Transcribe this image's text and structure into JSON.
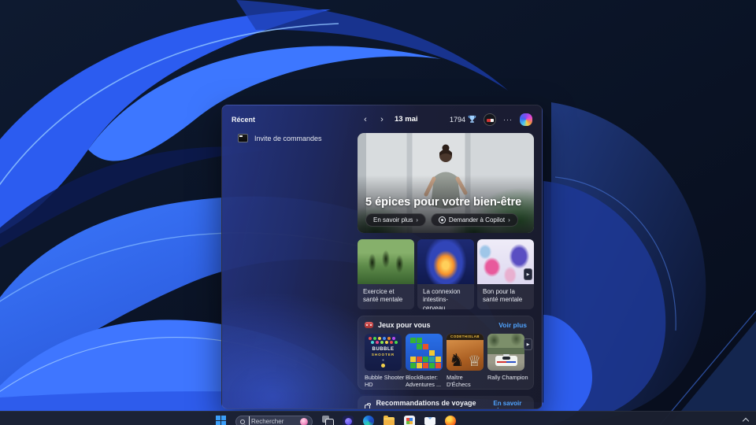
{
  "widgets": {
    "recent": {
      "title": "Récent",
      "items": [
        {
          "label": "Invite de commandes"
        }
      ]
    },
    "header": {
      "date": "13 mai",
      "points": "1794",
      "more_label": "···"
    },
    "hero": {
      "title": "5 épices pour votre bien-être",
      "learn_more": "En savoir plus",
      "ask_copilot": "Demander à Copilot"
    },
    "news": [
      {
        "title": "Exercice et santé mentale"
      },
      {
        "title": "La connexion intestins-cerveau"
      },
      {
        "title": "Bon pour la santé mentale"
      }
    ],
    "games": {
      "title": "Jeux pour vous",
      "see_more": "Voir plus",
      "items": [
        {
          "title": "Bubble Shooter HD",
          "art_line1": "BUBBLE",
          "art_line2": "SHOOTER"
        },
        {
          "title": "BlockBuster: Adventures ..."
        },
        {
          "title": "Maître D'Échecs",
          "banner": "CODETHISLAB",
          "piece_left": "♞",
          "piece_right": "♕"
        },
        {
          "title": "Rally Champion"
        }
      ]
    },
    "travel": {
      "title": "Recommandations de voyage pour vous",
      "link": "En savoir plus"
    }
  },
  "taskbar": {
    "search_placeholder": "Rechercher"
  },
  "icons": {
    "nav_prev": "‹",
    "nav_next": "›",
    "carousel_next": "▶",
    "button_chevron": "›"
  },
  "colors": {
    "accent_link": "#4fa3ff",
    "panel_left_blue": "#24347e",
    "panel_right_dark": "#1b1e30",
    "card_bg": "#343b50",
    "taskbar_bg": "#1b2030",
    "wallpaper_blue": "#2c5cf0",
    "copilot_gradient": [
      "#4ac8f0",
      "#3a6af0",
      "#8a4af0",
      "#e84ad0",
      "#f08a4a",
      "#f0d04a"
    ]
  }
}
